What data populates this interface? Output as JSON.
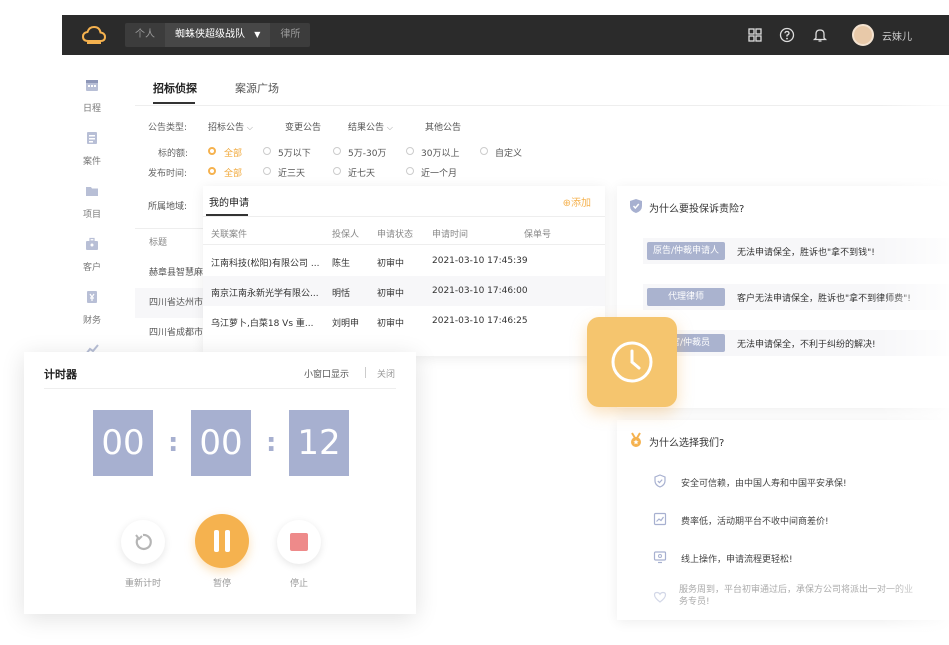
{
  "topbar": {
    "workspace_tabs": [
      "个人",
      "蜘蛛侠超级战队",
      "律所"
    ],
    "user_name": "云妹儿"
  },
  "sidebar": {
    "items": [
      {
        "label": "日程",
        "icon": "calendar-icon"
      },
      {
        "label": "案件",
        "icon": "case-icon"
      },
      {
        "label": "项目",
        "icon": "folder-icon"
      },
      {
        "label": "客户",
        "icon": "client-icon"
      },
      {
        "label": "财务",
        "icon": "finance-icon"
      }
    ]
  },
  "main": {
    "tabs": [
      "招标侦探",
      "案源广场"
    ],
    "filters": {
      "type_label": "公告类型:",
      "types": [
        "招标公告",
        "变更公告",
        "结果公告",
        "其他公告"
      ],
      "amount_label": "标的额:",
      "amounts": [
        "全部",
        "5万以下",
        "5万-30万",
        "30万以上",
        "自定义"
      ],
      "time_label": "发布时间:",
      "times": [
        "全部",
        "近三天",
        "近七天",
        "近一个月"
      ],
      "region_label": "所属地域:"
    },
    "list": {
      "header": "标题",
      "rows": [
        "赫章县智慧麻",
        "四川省达州市",
        "四川省成都市"
      ]
    }
  },
  "my_applications": {
    "title": "我的申请",
    "add_label": "添加",
    "columns": [
      "关联案件",
      "投保人",
      "申请状态",
      "申请时间",
      "保单号"
    ],
    "rows": [
      {
        "case": "江南科技(松阳)有限公司 ...",
        "applicant": "陈生",
        "status": "初审中",
        "time": "2021-03-10 17:45:39",
        "policy": ""
      },
      {
        "case": "南京江南永新光学有限公...",
        "applicant": "明恬",
        "status": "初审中",
        "time": "2021-03-10 17:46:00",
        "policy": ""
      },
      {
        "case": "乌江萝卜,白菜18 Vs 重...",
        "applicant": "刘明申",
        "status": "初审中",
        "time": "2021-03-10 17:46:25",
        "policy": ""
      }
    ]
  },
  "why_insurance": {
    "title": "为什么要投保诉责险?",
    "rows": [
      {
        "role": "原告/仲裁申请人",
        "text": "无法申请保全，胜诉也\"拿不到钱\"!"
      },
      {
        "role": "代理律师",
        "text": "客户无法申请保全，胜诉也\"拿不到律师费\"!"
      },
      {
        "role": "法官/仲裁员",
        "text": "无法申请保全，不利于纠纷的解决!"
      }
    ]
  },
  "why_us": {
    "title": "为什么选择我们?",
    "rows": [
      {
        "icon": "shield-check-icon",
        "text": "安全可信赖，由中国人寿和中国平安承保!"
      },
      {
        "icon": "trend-icon",
        "text": "费率低，活动期平台不收中间商差价!"
      },
      {
        "icon": "monitor-icon",
        "text": "线上操作，申请流程更轻松!"
      },
      {
        "icon": "heart-icon",
        "text": "服务周到，平台初审通过后，承保方公司将派出一对一的业务专员!"
      }
    ]
  },
  "timer": {
    "title": "计时器",
    "mini_window": "小窗口显示",
    "close": "关闭",
    "hours": "00",
    "minutes": "00",
    "seconds": "12",
    "reset_label": "重新计时",
    "pause_label": "暂停",
    "stop_label": "停止"
  },
  "colors": {
    "accent": "#f5b24f",
    "digit_bg": "#a7b0d0",
    "pill_bg": "#aab3cf",
    "topbar": "#2b2b2b"
  }
}
